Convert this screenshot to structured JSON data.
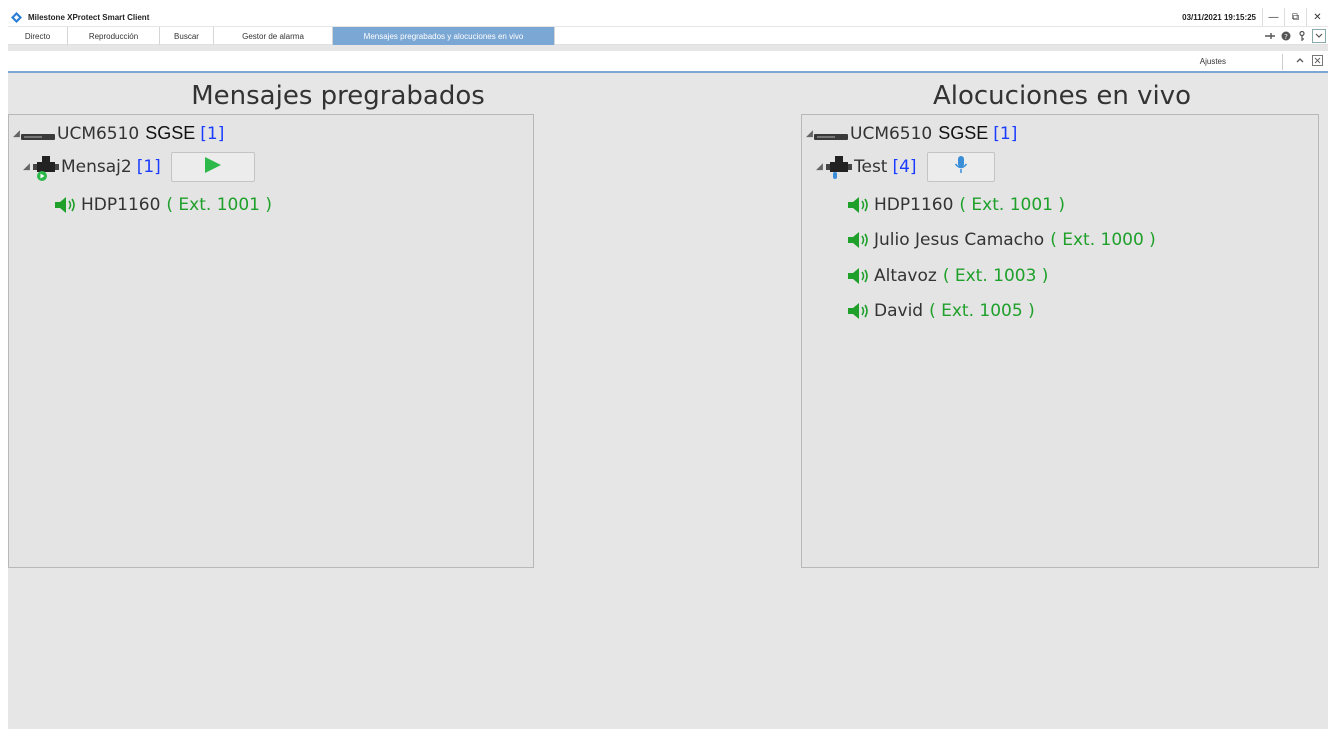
{
  "window": {
    "title": "Milestone XProtect Smart Client",
    "clock": "03/11/2021 19:15:25",
    "controls": {
      "minimize": "—",
      "restore": "⧉",
      "close": "✕"
    }
  },
  "tabs": [
    {
      "label": "Directo"
    },
    {
      "label": "Reproducción"
    },
    {
      "label": "Buscar"
    },
    {
      "label": "Gestor de alarma"
    },
    {
      "label": "Mensajes pregrabados y alocuciones en vivo"
    }
  ],
  "toolbar": {
    "settings_label": "Ajustes"
  },
  "left_panel": {
    "heading": "Mensajes pregrabados",
    "server": {
      "name": "UCM6510",
      "site": "SGSE",
      "count": "[1]"
    },
    "group": {
      "name": "Mensaj2",
      "count": "[1]"
    },
    "devices": [
      {
        "name": "HDP1160",
        "ext": "( Ext. 1001 )"
      }
    ]
  },
  "right_panel": {
    "heading": "Alocuciones en vivo",
    "server": {
      "name": "UCM6510",
      "site": "SGSE",
      "count": "[1]"
    },
    "group": {
      "name": "Test",
      "count": "[4]"
    },
    "devices": [
      {
        "name": "HDP1160",
        "ext": "( Ext. 1001 )"
      },
      {
        "name": "Julio Jesus Camacho",
        "ext": "( Ext. 1000 )"
      },
      {
        "name": "Altavoz",
        "ext": "( Ext. 1003 )"
      },
      {
        "name": "David",
        "ext": "( Ext. 1005 )"
      }
    ]
  },
  "colors": {
    "accent_tab": "#7aa7d4",
    "count_blue": "#1a3cff",
    "ext_green": "#1fa02b",
    "play_green": "#2db84a",
    "mic_blue": "#3a8ed8"
  },
  "icons": {
    "app": "milestone-logo-icon",
    "device": "server-device-icon",
    "group": "speaker-group-icon",
    "speaker": "speaker-icon",
    "play": "play-icon",
    "mic": "microphone-icon"
  }
}
